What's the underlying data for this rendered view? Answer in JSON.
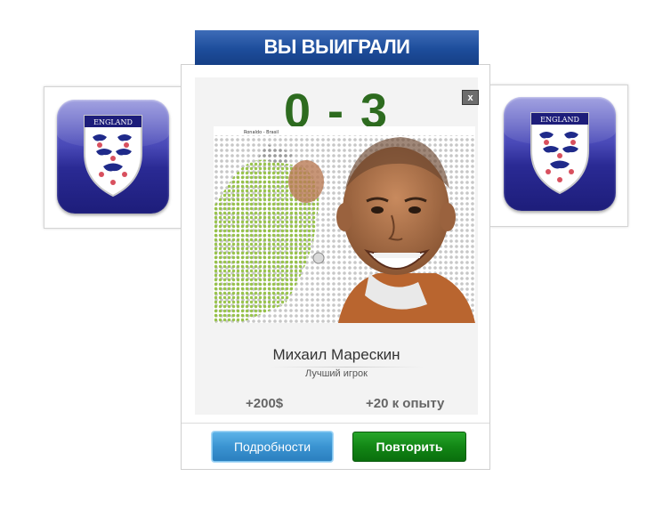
{
  "banner": {
    "title": "ВЫ ВЫИГРАЛИ"
  },
  "badges": {
    "text": "ENGLAND"
  },
  "result": {
    "score": "0 - 3",
    "close_label": "x"
  },
  "photo": {
    "caption": "Ronaldo - Brasil"
  },
  "player": {
    "name": "Михаил Марескин",
    "subtitle": "Лучший игрок"
  },
  "rewards": {
    "money": "+200$",
    "experience": "+20 к опыту"
  },
  "buttons": {
    "details": "Подробности",
    "retry": "Повторить"
  },
  "colors": {
    "banner": "#1d4d9b",
    "score": "#2d6b1f",
    "details_button": "#3a93d1",
    "retry_button": "#128615",
    "badge": "#2a2a94"
  }
}
